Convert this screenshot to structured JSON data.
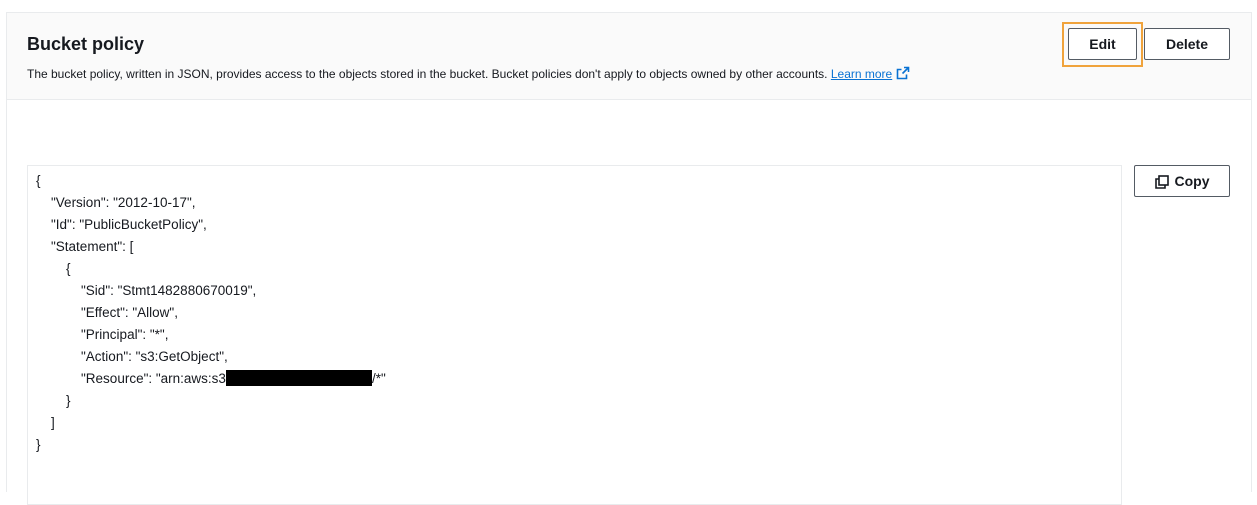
{
  "header": {
    "title": "Bucket policy",
    "description": "The bucket policy, written in JSON, provides access to the objects stored in the bucket. Bucket policies don't apply to objects owned by other accounts.",
    "learn_more": "Learn more"
  },
  "buttons": {
    "edit": "Edit",
    "delete": "Delete",
    "copy": "Copy"
  },
  "colors": {
    "accent_highlight": "#f0a33c",
    "link": "#0972d3",
    "header_bg": "#fafafa"
  },
  "icons": {
    "external_link": "external-link-icon",
    "copy": "copy-icon"
  },
  "policy": {
    "lines": [
      "{",
      "    \"Version\": \"2012-10-17\",",
      "    \"Id\": \"PublicBucketPolicy\",",
      "    \"Statement\": [",
      "        {",
      "            \"Sid\": \"Stmt1482880670019\",",
      "            \"Effect\": \"Allow\",",
      "            \"Principal\": \"*\",",
      "            \"Action\": \"s3:GetObject\","
    ],
    "resource_prefix": "            \"Resource\": \"arn:aws:s3",
    "resource_suffix": "/*\"",
    "closing_lines": [
      "        }",
      "    ]",
      "}"
    ]
  }
}
